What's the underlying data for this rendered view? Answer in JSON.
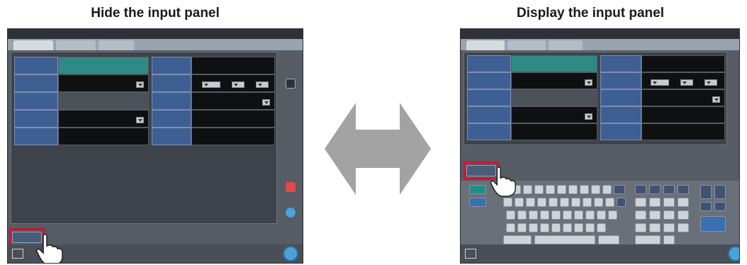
{
  "captions": {
    "left": "Hide the input panel",
    "right": "Display the input panel"
  },
  "colors": {
    "screen_bg": "#565b64",
    "label_blue": "#3e5f93",
    "value_teal": "#2e8a84",
    "highlight_red": "#d4142a",
    "arrow_grey": "#a3a3a3"
  },
  "icons": {
    "arrow": "double-headed-arrow-icon",
    "hand": "pointing-hand-icon",
    "grid": "grid-icon"
  }
}
